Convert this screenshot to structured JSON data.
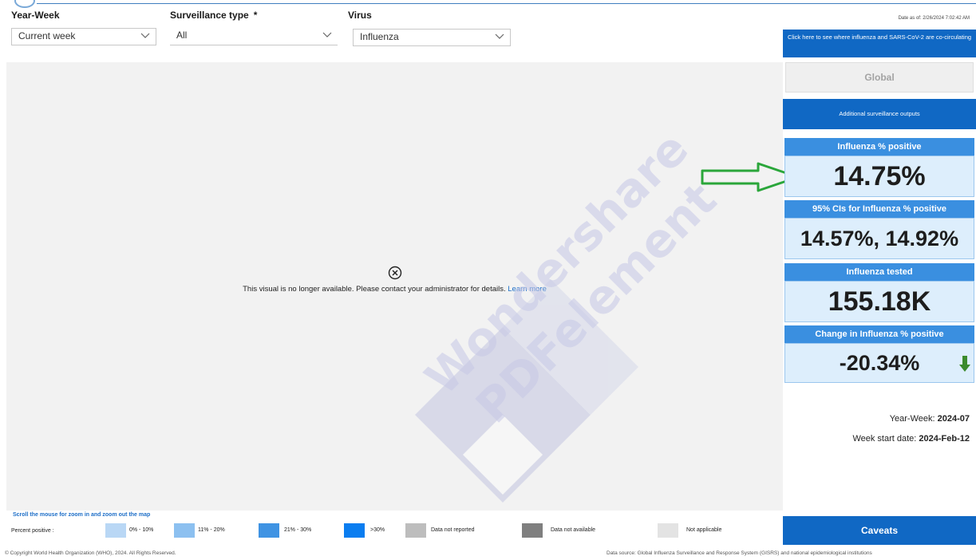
{
  "filters": {
    "year_week": {
      "label": "Year-Week",
      "value": "Current week"
    },
    "surveillance": {
      "label": "Surveillance type",
      "required_mark": "*",
      "value": "All"
    },
    "virus": {
      "label": "Virus",
      "value": "Influenza"
    }
  },
  "map": {
    "message": "This visual is no longer available. Please contact your administrator for details.",
    "learn_more": "Learn more",
    "scroll_hint": "Scroll the mouse for zoom in and zoom out the map"
  },
  "legend": {
    "title": "Percent positive :",
    "items": [
      {
        "label": "0% - 10%",
        "color": "#b9d7f5"
      },
      {
        "label": "11% - 20%",
        "color": "#8cc0f0"
      },
      {
        "label": "21% - 30%",
        "color": "#3f93e3"
      },
      {
        "label": ">30%",
        "color": "#0a7df0"
      },
      {
        "label": "Data not reported",
        "color": "#bdbdbd"
      },
      {
        "label": "Data not available",
        "color": "#7f7f7f"
      },
      {
        "label": "Not applicable",
        "color": "#e3e3e3"
      }
    ]
  },
  "right_panel": {
    "date_as_of": "Date as of: 2/26/2024 7:02:42 AM",
    "cocirculating_button": "Click here to see where influenza and SARS-CoV-2 are co-circulating",
    "global_button": "Global",
    "additional_button": "Additional surveillance outputs",
    "cards": [
      {
        "title": "Influenza % positive",
        "value": "14.75%"
      },
      {
        "title": "95% CIs for Influenza % positive",
        "value": "14.57%, 14.92%"
      },
      {
        "title": "Influenza tested",
        "value": "155.18K"
      },
      {
        "title": "Change in Influenza % positive",
        "value": "-20.34%"
      }
    ],
    "year_week_label": "Year-Week:",
    "year_week_value": "2024-07",
    "week_start_label": "Week start date:",
    "week_start_value": "2024-Feb-12",
    "caveats_button": "Caveats"
  },
  "footer": {
    "copyright": "© Copyright World Health Organization (WHO), 2024. All Rights Reserved.",
    "data_source": "Data source: Global Influenza Surveillance and Response System (GISRS) and national epidemiological institutions"
  },
  "watermark": {
    "line1": "Wondershare",
    "line2": "PDFelement"
  },
  "colors": {
    "accent": "#1068c4",
    "card_header": "#3a8fe0",
    "card_body": "#ddeefc",
    "arrow_green": "#2aa63a"
  }
}
